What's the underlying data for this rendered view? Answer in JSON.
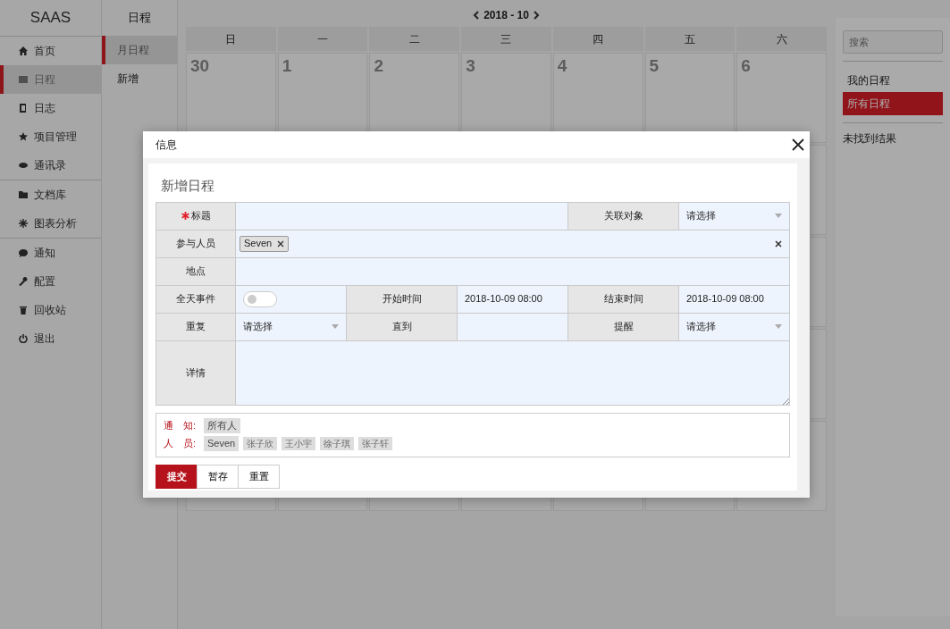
{
  "app": {
    "logo": "SAAS"
  },
  "sidebar": {
    "groups": [
      [
        {
          "label": "首页",
          "selected": false
        },
        {
          "label": "日程",
          "selected": true
        },
        {
          "label": "日志",
          "selected": false
        },
        {
          "label": "项目管理",
          "selected": false
        },
        {
          "label": "通讯录",
          "selected": false
        }
      ],
      [
        {
          "label": "文档库",
          "selected": false
        },
        {
          "label": "图表分析",
          "selected": false
        }
      ],
      [
        {
          "label": "通知",
          "selected": false
        },
        {
          "label": "配置",
          "selected": false
        },
        {
          "label": "回收站",
          "selected": false
        },
        {
          "label": "退出",
          "selected": false
        }
      ]
    ]
  },
  "subnav": {
    "title": "日程",
    "items": [
      {
        "label": "月日程",
        "selected": true
      },
      {
        "label": "新增",
        "selected": false
      }
    ]
  },
  "calendar": {
    "month": "2018 - 10",
    "weekdays": [
      "日",
      "一",
      "二",
      "三",
      "四",
      "五",
      "六"
    ],
    "first_week": [
      "30",
      "1",
      "2",
      "3",
      "4",
      "5",
      "6"
    ]
  },
  "right_panel": {
    "search": {
      "placeholder": "搜索"
    },
    "filters": [
      {
        "label": "我的日程",
        "selected": false
      },
      {
        "label": "所有日程",
        "selected": true
      }
    ],
    "empty_text": "未找到结果"
  },
  "modal": {
    "title": "信息",
    "form_title": "新增日程",
    "rows": [
      [
        {
          "kind": "label",
          "text": "标题",
          "required": true
        },
        {
          "kind": "input"
        },
        "",
        "",
        {
          "kind": "label",
          "text": "关联对象"
        },
        {
          "kind": "select",
          "value": "请选择"
        }
      ],
      [
        {
          "kind": "label",
          "text": "参与人员"
        },
        {
          "kind": "tags",
          "tags": [
            "Seven"
          ]
        },
        "",
        "",
        "",
        ""
      ],
      [
        {
          "kind": "label",
          "text": "地点"
        },
        {
          "kind": "input"
        },
        "",
        "",
        "",
        ""
      ],
      [
        {
          "kind": "label",
          "text": "全天事件"
        },
        {
          "kind": "toggle",
          "on": false
        },
        {
          "kind": "label",
          "text": "开始时间"
        },
        {
          "kind": "input",
          "value": "2018-10-09 08:00"
        },
        {
          "kind": "label",
          "text": "结束时间"
        },
        {
          "kind": "input",
          "value": "2018-10-09 08:00"
        }
      ],
      [
        {
          "kind": "label",
          "text": "重复"
        },
        {
          "kind": "select",
          "value": "请选择"
        },
        {
          "kind": "label",
          "text": "直到"
        },
        {
          "kind": "input"
        },
        {
          "kind": "label",
          "text": "提醒"
        },
        {
          "kind": "select",
          "value": "请选择"
        }
      ],
      [
        {
          "kind": "label",
          "text": "详情"
        },
        {
          "kind": "textarea"
        },
        "",
        "",
        "",
        ""
      ]
    ],
    "notice": [
      {
        "label": "通　知:",
        "people": [
          "所有人"
        ]
      },
      {
        "label": "人　员:",
        "people": [
          "Seven",
          "张子欣",
          "王小宇",
          "徐子琪",
          "张子轩"
        ]
      }
    ],
    "buttons": [
      {
        "label": "提交",
        "kind": "primary"
      },
      {
        "label": "暂存",
        "kind": "plain"
      },
      {
        "label": "重置",
        "kind": "plain"
      }
    ]
  }
}
